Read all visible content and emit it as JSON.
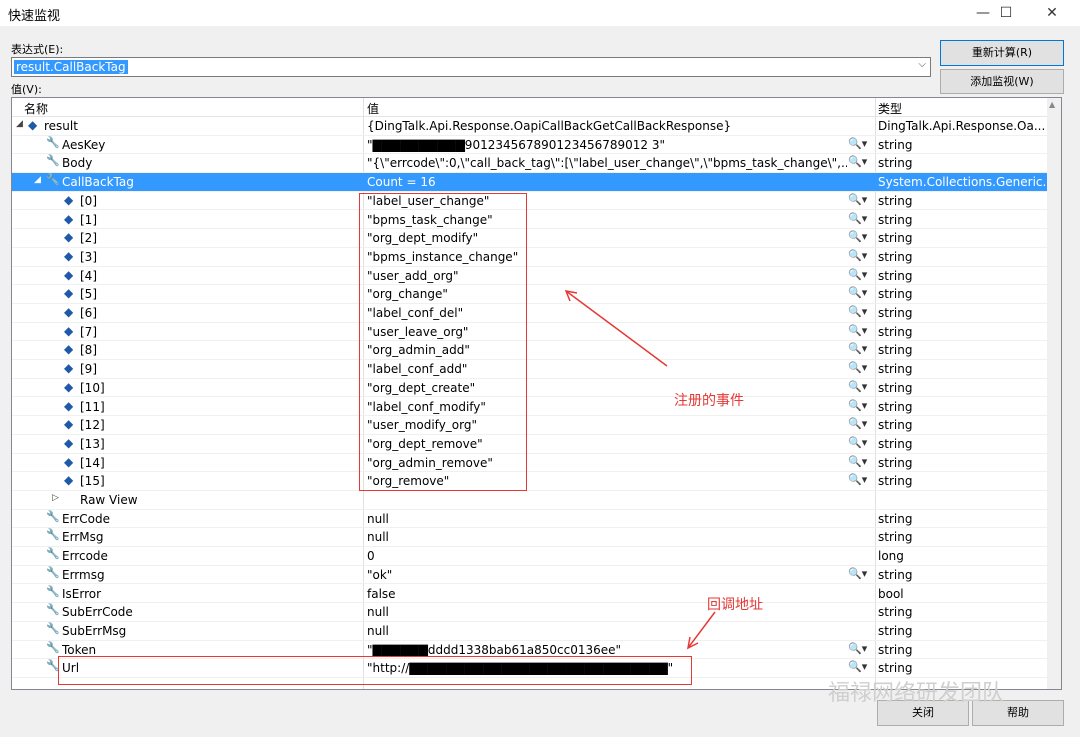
{
  "window": {
    "title": "快速监视",
    "minimize": "—",
    "maximize": "☐",
    "close": "✕"
  },
  "labels": {
    "expression": "表达式(E):",
    "value": "值(V):"
  },
  "expression": {
    "value": "result.CallBackTag"
  },
  "buttons": {
    "recalculate": "重新计算(R)",
    "add_watch": "添加监视(W)",
    "close": "关闭",
    "help": "帮助"
  },
  "columns": {
    "name": "名称",
    "value": "值",
    "type": "类型"
  },
  "rows": [
    {
      "name": "result",
      "value": "{DingTalk.Api.Response.OapiCallBackGetCallBackResponse}",
      "type": "DingTalk.Api.Response.Oa...",
      "icon": "blue-cube-icon"
    },
    {
      "name": "AesKey",
      "value": "\"▇▇▇▇▇▇▇▇▇▇901234567890123456789012 3\"",
      "type": "string",
      "icon": "wrench-icon",
      "mag": true
    },
    {
      "name": "Body",
      "value": "\"{\\\"errcode\\\":0,\\\"call_back_tag\\\":[\\\"label_user_change\\\",\\\"bpms_task_change\\\",...",
      "type": "string",
      "icon": "wrench-icon",
      "mag": true
    },
    {
      "name": "CallBackTag",
      "value": "Count = 16",
      "type": "System.Collections.Generic....",
      "icon": "wrench-icon",
      "selected": true
    },
    {
      "name": "[0]",
      "value": "\"label_user_change\"",
      "type": "string",
      "icon": "blue-cube-icon",
      "mag": true
    },
    {
      "name": "[1]",
      "value": "\"bpms_task_change\"",
      "type": "string",
      "icon": "blue-cube-icon",
      "mag": true
    },
    {
      "name": "[2]",
      "value": "\"org_dept_modify\"",
      "type": "string",
      "icon": "blue-cube-icon",
      "mag": true
    },
    {
      "name": "[3]",
      "value": "\"bpms_instance_change\"",
      "type": "string",
      "icon": "blue-cube-icon",
      "mag": true
    },
    {
      "name": "[4]",
      "value": "\"user_add_org\"",
      "type": "string",
      "icon": "blue-cube-icon",
      "mag": true
    },
    {
      "name": "[5]",
      "value": "\"org_change\"",
      "type": "string",
      "icon": "blue-cube-icon",
      "mag": true
    },
    {
      "name": "[6]",
      "value": "\"label_conf_del\"",
      "type": "string",
      "icon": "blue-cube-icon",
      "mag": true
    },
    {
      "name": "[7]",
      "value": "\"user_leave_org\"",
      "type": "string",
      "icon": "blue-cube-icon",
      "mag": true
    },
    {
      "name": "[8]",
      "value": "\"org_admin_add\"",
      "type": "string",
      "icon": "blue-cube-icon",
      "mag": true
    },
    {
      "name": "[9]",
      "value": "\"label_conf_add\"",
      "type": "string",
      "icon": "blue-cube-icon",
      "mag": true
    },
    {
      "name": "[10]",
      "value": "\"org_dept_create\"",
      "type": "string",
      "icon": "blue-cube-icon",
      "mag": true
    },
    {
      "name": "[11]",
      "value": "\"label_conf_modify\"",
      "type": "string",
      "icon": "blue-cube-icon",
      "mag": true
    },
    {
      "name": "[12]",
      "value": "\"user_modify_org\"",
      "type": "string",
      "icon": "blue-cube-icon",
      "mag": true
    },
    {
      "name": "[13]",
      "value": "\"org_dept_remove\"",
      "type": "string",
      "icon": "blue-cube-icon",
      "mag": true
    },
    {
      "name": "[14]",
      "value": "\"org_admin_remove\"",
      "type": "string",
      "icon": "blue-cube-icon",
      "mag": true
    },
    {
      "name": "[15]",
      "value": "\"org_remove\"",
      "type": "string",
      "icon": "blue-cube-icon",
      "mag": true
    },
    {
      "name": "Raw View",
      "value": "",
      "type": "",
      "icon": "none"
    },
    {
      "name": "ErrCode",
      "value": "null",
      "type": "string",
      "icon": "wrench-icon"
    },
    {
      "name": "ErrMsg",
      "value": "null",
      "type": "string",
      "icon": "wrench-icon"
    },
    {
      "name": "Errcode",
      "value": "0",
      "type": "long",
      "icon": "wrench-icon"
    },
    {
      "name": "Errmsg",
      "value": "\"ok\"",
      "type": "string",
      "icon": "wrench-icon",
      "mag": true
    },
    {
      "name": "IsError",
      "value": "false",
      "type": "bool",
      "icon": "wrench-icon"
    },
    {
      "name": "SubErrCode",
      "value": "null",
      "type": "string",
      "icon": "wrench-icon"
    },
    {
      "name": "SubErrMsg",
      "value": "null",
      "type": "string",
      "icon": "wrench-icon"
    },
    {
      "name": "Token",
      "value": "\"▇▇▇▇▇▇dddd1338bab61a850cc0136ee\"",
      "type": "string",
      "icon": "wrench-icon",
      "mag": true
    },
    {
      "name": "Url",
      "value": "\"http://▇▇▇▇▇▇▇▇▇▇▇▇▇▇▇▇▇▇▇▇▇▇▇▇▇▇▇▇\"",
      "type": "string",
      "icon": "wrench-icon",
      "mag": true
    }
  ],
  "annotations": {
    "events": "注册的事件",
    "callback_url": "回调地址"
  },
  "watermark": "福禄网络研发团队",
  "colors": {
    "selection": "#3399ff",
    "annotation": "#e53935"
  }
}
